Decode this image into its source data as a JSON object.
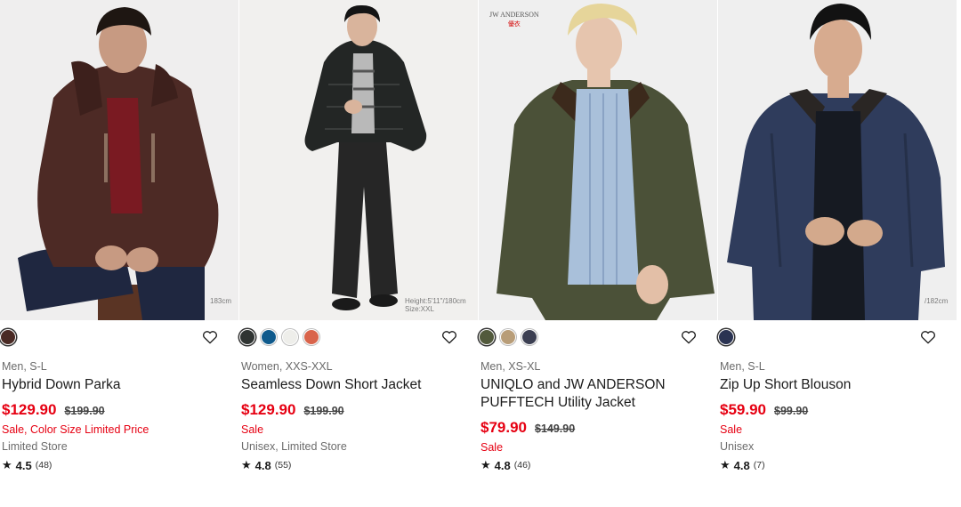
{
  "products": [
    {
      "swatches": [
        "#4a2a24"
      ],
      "gender_size": "Men, S-L",
      "name_lines": [
        "Hybrid Down Parka"
      ],
      "price": "$129.90",
      "was_price": "$199.90",
      "sale_note": "Sale, Color Size Limited Price",
      "availability": "Limited Store",
      "rating": "4.5",
      "reviews": "(48)",
      "height_tag": "183cm"
    },
    {
      "swatches": [
        "#2f3432",
        "#0f5a8c",
        "#eeeeea",
        "#d9644b"
      ],
      "gender_size": "Women, XXS-XXL",
      "name_lines": [
        "Seamless Down Short Jacket"
      ],
      "price": "$129.90",
      "was_price": "$199.90",
      "sale_note": "Sale",
      "availability": "Unisex, Limited Store",
      "rating": "4.8",
      "reviews": "(55)",
      "height_tag": "Height:5'11\"/180cm",
      "size_tag": "Size:XXL"
    },
    {
      "swatches": [
        "#525a3c",
        "#b89d78",
        "#3c3f52"
      ],
      "gender_size": "Men, XS-XL",
      "name_lines": [
        "UNIQLO and JW ANDERSON",
        "PUFFTECH Utility Jacket"
      ],
      "price": "$79.90",
      "was_price": "$149.90",
      "sale_note": "Sale",
      "availability": "",
      "rating": "4.8",
      "reviews": "(46)",
      "brand_top": "JW ANDERSON",
      "brand_sub": "優衣"
    },
    {
      "swatches": [
        "#2a3352"
      ],
      "gender_size": "Men, S-L",
      "name_lines": [
        "Zip Up Short Blouson"
      ],
      "price": "$59.90",
      "was_price": "$99.90",
      "sale_note": "Sale",
      "availability": "Unisex",
      "rating": "4.8",
      "reviews": "(7)",
      "height_tag": "/182cm"
    }
  ],
  "icons": {
    "favorite": "heart-outline-icon",
    "rating": "star-icon"
  },
  "colors": {
    "sale_red": "#e60012"
  }
}
